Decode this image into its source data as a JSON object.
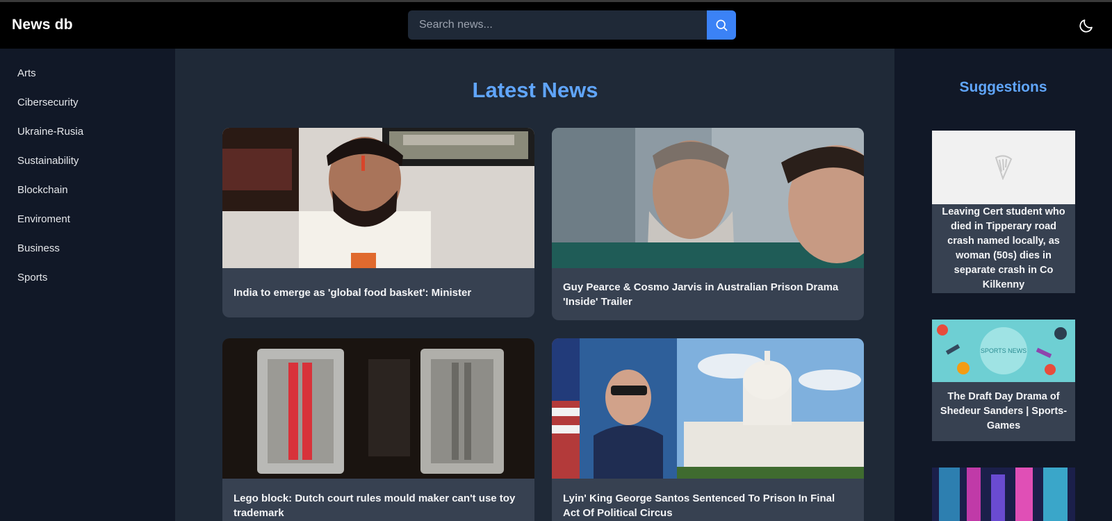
{
  "header": {
    "logo": "News db",
    "search_placeholder": "Search news...",
    "search_icon": "search-icon",
    "theme_icon": "moon-icon"
  },
  "sidebar": {
    "items": [
      {
        "label": "Arts"
      },
      {
        "label": "Cibersecurity"
      },
      {
        "label": "Ukraine-Rusia"
      },
      {
        "label": "Sustainability"
      },
      {
        "label": "Blockchain"
      },
      {
        "label": "Enviroment"
      },
      {
        "label": "Business"
      },
      {
        "label": "Sports"
      }
    ]
  },
  "main": {
    "title": "Latest News",
    "cards": [
      {
        "title": "India to emerge as 'global food basket': Minister"
      },
      {
        "title": "Guy Pearce & Cosmo Jarvis in Australian Prison Drama 'Inside' Trailer"
      },
      {
        "title": "Lego block: Dutch court rules mould maker can't use toy trademark"
      },
      {
        "title": "Lyin' King George Santos Sentenced To Prison In Final Act Of Political Circus"
      }
    ]
  },
  "suggestions": {
    "title": "Suggestions",
    "items": [
      {
        "title": "Leaving Cert student who died in Tipperary road crash named locally, as woman (50s) dies in separate crash in Co Kilkenny"
      },
      {
        "title": "The Draft Day Drama of Shedeur Sanders | Sports-Games",
        "image_text": "SPORTS NEWS"
      },
      {
        "title": ""
      }
    ]
  },
  "colors": {
    "accent": "#60a5fa",
    "search_button": "#3b82f6",
    "header_bg": "#000000",
    "sidebar_bg": "#111827",
    "main_bg": "#1f2937",
    "card_bg": "#374151"
  }
}
